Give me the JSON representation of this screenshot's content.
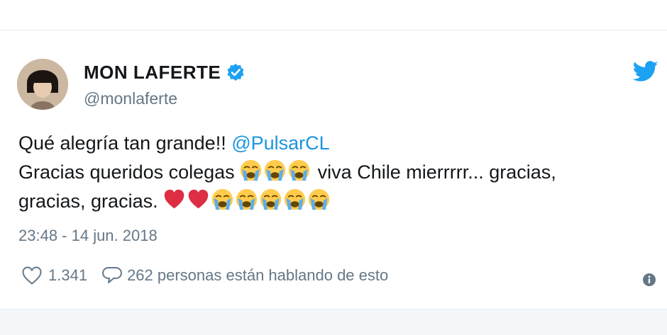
{
  "tweet": {
    "display_name": "MON LAFERTE",
    "handle": "@monlaferte",
    "text_line1_prefix": "Qué alegría tan grande!! ",
    "mention": "@PulsarCL",
    "text_line2_prefix": "Gracias queridos colegas ",
    "text_line2_suffix": " viva Chile mierrrrr... gracias,",
    "text_line3_prefix": "gracias, gracias. ",
    "timestamp": "23:48 - 14 jun. 2018",
    "likes": "1.341",
    "conversation": "262 personas están hablando de esto",
    "emojis": {
      "crying": "loudly-crying-face",
      "heart": "red-heart"
    }
  },
  "colors": {
    "text": "#14171a",
    "secondary": "#657786",
    "accent": "#1b95e0",
    "divider": "#e1e8ed",
    "heart": "#e0245e"
  }
}
